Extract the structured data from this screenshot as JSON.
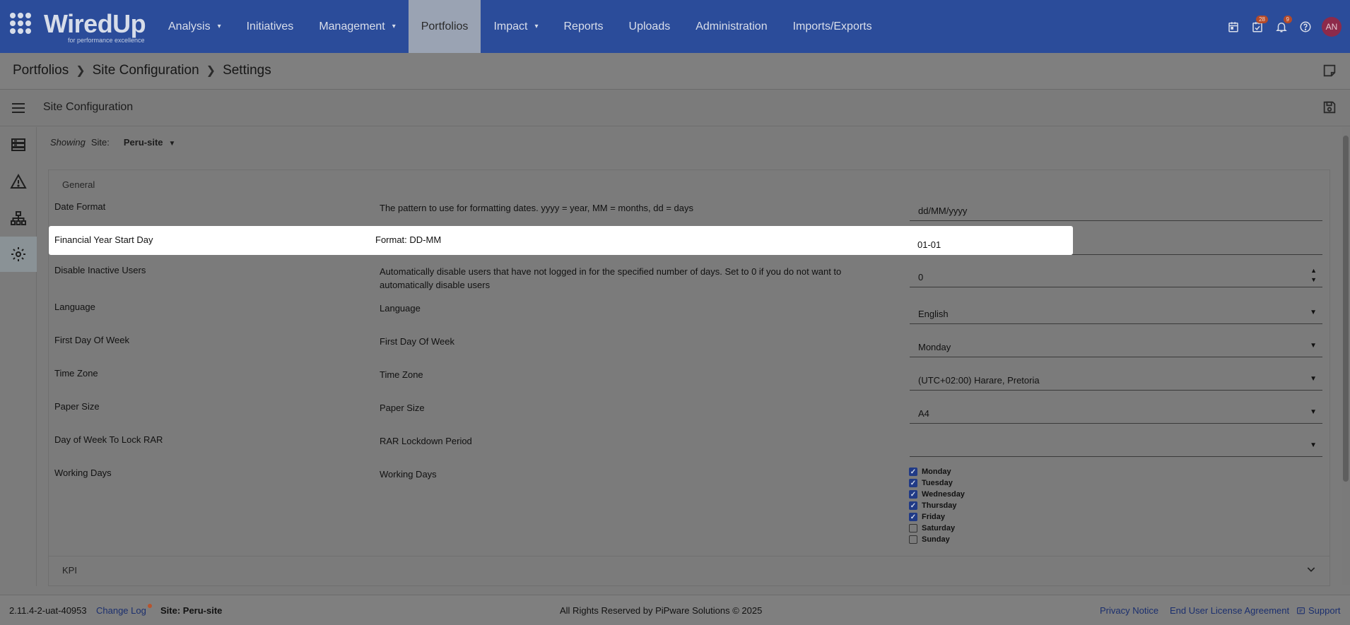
{
  "nav": {
    "logo_text": "WiredUp",
    "logo_tagline": "for performance excellence",
    "items": [
      {
        "label": "Analysis",
        "caret": "▾"
      },
      {
        "label": "Initiatives",
        "caret": ""
      },
      {
        "label": "Management",
        "caret": "▾"
      },
      {
        "label": "Portfolios",
        "caret": ""
      },
      {
        "label": "Impact",
        "caret": "▾"
      },
      {
        "label": "Reports",
        "caret": ""
      },
      {
        "label": "Uploads",
        "caret": ""
      },
      {
        "label": "Administration",
        "caret": ""
      },
      {
        "label": "Imports/Exports",
        "caret": ""
      }
    ],
    "active_item": "Portfolios",
    "tasks_badge": "28",
    "notifications_badge": "9",
    "avatar_initials": "AN",
    "icons": [
      "calendar-icon",
      "tasks-icon",
      "bell-icon",
      "help-icon"
    ]
  },
  "breadcrumb": {
    "items": [
      "Portfolios",
      "Site Configuration",
      "Settings"
    ],
    "separator": ">"
  },
  "section": {
    "title": "Site Configuration"
  },
  "filter": {
    "showing_label": "Showing",
    "site_label": "Site:",
    "site_value": "Peru-site"
  },
  "general": {
    "title": "General",
    "rows": [
      {
        "label": "Date Format",
        "description": "The pattern to use for formatting dates. yyyy = year, MM = months, dd = days",
        "value": "dd/MM/yyyy"
      },
      {
        "label": "Financial Year Start Day",
        "description": "Format: DD-MM",
        "value": "01-01"
      },
      {
        "label": "Disable Inactive Users",
        "description": "Automatically disable users that have not logged in for the specified number of days. Set to 0 if you do not want to automatically disable users",
        "value": "0"
      },
      {
        "label": "Language",
        "description": "Language",
        "value": "English"
      },
      {
        "label": "First Day Of Week",
        "description": "First Day Of Week",
        "value": "Monday"
      },
      {
        "label": "Time Zone",
        "description": "Time Zone",
        "value": "(UTC+02:00) Harare, Pretoria"
      },
      {
        "label": "Paper Size",
        "description": "Paper Size",
        "value": "A4"
      },
      {
        "label": "Day of Week To Lock RAR",
        "description": "RAR Lockdown Period",
        "value": ""
      },
      {
        "label": "Working Days",
        "description": "Working Days",
        "value": ""
      }
    ],
    "working_days": [
      {
        "day": "Monday",
        "checked": true
      },
      {
        "day": "Tuesday",
        "checked": true
      },
      {
        "day": "Wednesday",
        "checked": true
      },
      {
        "day": "Thursday",
        "checked": true
      },
      {
        "day": "Friday",
        "checked": true
      },
      {
        "day": "Saturday",
        "checked": false
      },
      {
        "day": "Sunday",
        "checked": false
      }
    ]
  },
  "kpi": {
    "title": "KPI"
  },
  "footer": {
    "version": "2.11.4-2-uat-40953",
    "change_log": "Change Log",
    "site": "Site: Peru-site",
    "copyright": "All Rights Reserved by PiPware Solutions © 2025",
    "privacy": "Privacy Notice",
    "eula": "End User License Agreement",
    "support": "Support"
  },
  "colors": {
    "nav_bg": "#2b4c9a",
    "overlay_bg": "#7b7b7b",
    "highlight_bg": "#ffffff",
    "checkbox_on": "#203a86",
    "badge": "#b44a2a",
    "avatar": "#8d2a4a"
  }
}
